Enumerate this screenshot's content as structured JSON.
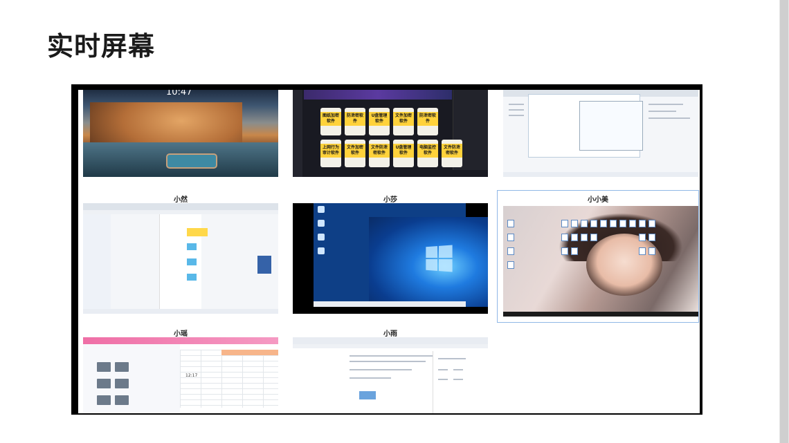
{
  "page": {
    "title": "实时屏幕"
  },
  "tiles": [
    {
      "name": "",
      "clock": "10:47"
    },
    {
      "name": "",
      "cards": [
        "图纸加密软件",
        "防泄密软件",
        "U盘管理软件",
        "文件加密软件",
        "防泄密软件",
        "",
        "上网行为审计软件",
        "文件加密软件",
        "文件防泄密软件",
        "U盘管理软件",
        "电脑监控软件",
        "文件防泄密软件"
      ]
    },
    {
      "name": ""
    },
    {
      "name": "小然"
    },
    {
      "name": "小莎"
    },
    {
      "name": "小小美"
    },
    {
      "name": "小瑶",
      "clock": "12:17"
    },
    {
      "name": "小雨"
    }
  ],
  "colors": {
    "wall_border": "#000000",
    "selected_outline": "#8fb7e6"
  }
}
